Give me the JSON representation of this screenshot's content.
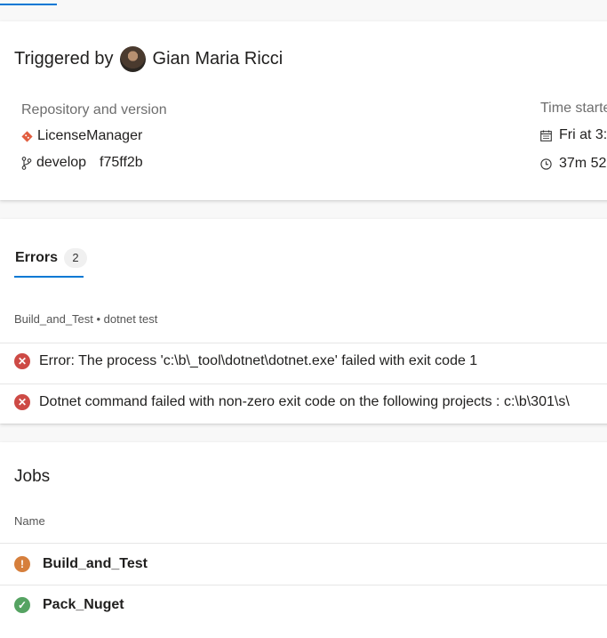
{
  "summary": {
    "triggered_prefix": "Triggered by",
    "triggered_user": "Gian Maria Ricci",
    "repo_heading": "Repository and version",
    "repo_name": "LicenseManager",
    "branch": "develop",
    "commit": "f75ff2b",
    "time_heading": "Time starte",
    "time_started": "Fri at 3:",
    "duration": "37m 52"
  },
  "errors": {
    "tab_label": "Errors",
    "count": "2",
    "group_label": "Build_and_Test • dotnet test",
    "items": [
      {
        "message": "Error: The process 'c:\\b\\_tool\\dotnet\\dotnet.exe' failed with exit code 1"
      },
      {
        "message": "Dotnet command failed with non-zero exit code on the following projects : c:\\b\\301\\s\\"
      }
    ]
  },
  "jobs": {
    "title": "Jobs",
    "column_name": "Name",
    "items": [
      {
        "name": "Build_and_Test",
        "status_icon": "warning-icon"
      },
      {
        "name": "Pack_Nuget",
        "status_icon": "success-icon"
      }
    ]
  },
  "colors": {
    "accent": "#0078d4",
    "error": "#cd4a45",
    "warning": "#d67f3c",
    "success": "#55a362",
    "git": "#e15d3f"
  }
}
